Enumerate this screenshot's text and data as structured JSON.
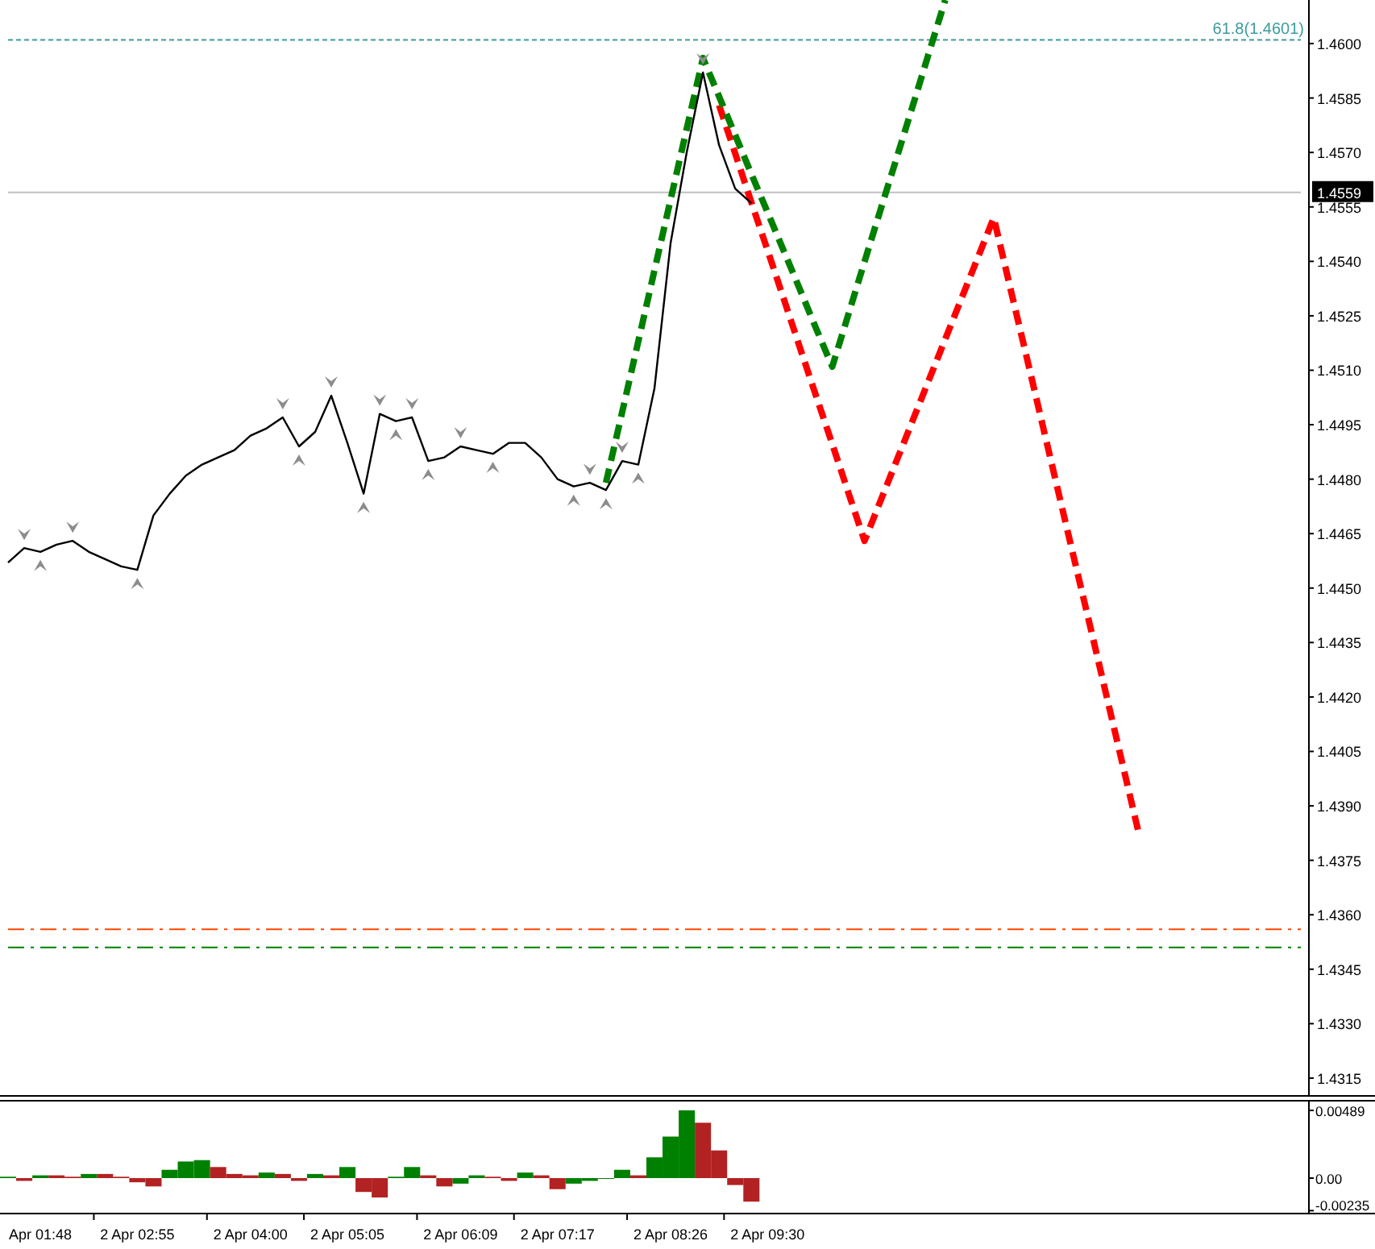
{
  "main_chart": {
    "chart_data": {
      "type": "line",
      "ylim": [
        1.43101,
        1.4612
      ],
      "categories": [
        null,
        null,
        null,
        null,
        null,
        null,
        null,
        null,
        null,
        null,
        null,
        null,
        null,
        null,
        null,
        null,
        null,
        null,
        null,
        null,
        null,
        null,
        null,
        null,
        null,
        null,
        null,
        null,
        null,
        null,
        null,
        null,
        null,
        null,
        null,
        null,
        null,
        null,
        null,
        null,
        null,
        null,
        null,
        null,
        null,
        null,
        null,
        null,
        null,
        null,
        null,
        null,
        null,
        null,
        null,
        null,
        null,
        null,
        null,
        null,
        null,
        null,
        null,
        null,
        null,
        null,
        null,
        null,
        null,
        null,
        null,
        null,
        null,
        null,
        null,
        null,
        null,
        null,
        null,
        null,
        null
      ],
      "yticks": [
        {
          "value": 1.46,
          "label": "1.4600"
        },
        {
          "value": 1.4585,
          "label": "1.4585"
        },
        {
          "value": 1.457,
          "label": "1.4570"
        },
        {
          "value": 1.4555,
          "label": "1.4555"
        },
        {
          "value": 1.454,
          "label": "1.4540"
        },
        {
          "value": 1.4525,
          "label": "1.4525"
        },
        {
          "value": 1.451,
          "label": "1.4510"
        },
        {
          "value": 1.4495,
          "label": "1.4495"
        },
        {
          "value": 1.448,
          "label": "1.4480"
        },
        {
          "value": 1.4465,
          "label": "1.4465"
        },
        {
          "value": 1.445,
          "label": "1.4450"
        },
        {
          "value": 1.4435,
          "label": "1.4435"
        },
        {
          "value": 1.442,
          "label": "1.4420"
        },
        {
          "value": 1.4405,
          "label": "1.4405"
        },
        {
          "value": 1.439,
          "label": "1.4390"
        },
        {
          "value": 1.4375,
          "label": "1.4375"
        },
        {
          "value": 1.436,
          "label": "1.4360"
        },
        {
          "value": 1.4345,
          "label": "1.4345"
        },
        {
          "value": 1.433,
          "label": "1.4330"
        },
        {
          "value": 1.4315,
          "label": "1.4315"
        }
      ],
      "series": [
        {
          "color": "#000000",
          "values": [
            1.4457,
            1.4461,
            1.446,
            1.4462,
            1.4463,
            1.446,
            1.4458,
            1.4456,
            1.4455,
            1.447,
            1.4476,
            1.4481,
            1.4484,
            1.4486,
            1.4488,
            1.4492,
            1.4494,
            1.4497,
            1.4489,
            1.4493,
            1.4503,
            1.449,
            1.4476,
            1.4498,
            1.4496,
            1.4497,
            1.4485,
            1.4486,
            1.4489,
            1.4488,
            1.4487,
            1.449,
            1.449,
            1.4486,
            1.448,
            1.4478,
            1.4479,
            1.4477,
            1.4485,
            1.4484,
            1.4505,
            1.4545,
            1.457,
            1.4592,
            1.4572,
            1.456,
            1.4556,
            null,
            null,
            null,
            null,
            null,
            null,
            null,
            null,
            null,
            null,
            null,
            null,
            null,
            null,
            null,
            null,
            null,
            null,
            null,
            null,
            null,
            null,
            null,
            null,
            null,
            null,
            null,
            null,
            null,
            null,
            null,
            null,
            null,
            null
          ]
        },
        {
          "color": "#008000",
          "line_style": "dashed",
          "values": [
            null,
            null,
            null,
            null,
            null,
            null,
            null,
            null,
            null,
            null,
            null,
            null,
            null,
            null,
            null,
            null,
            null,
            null,
            null,
            null,
            null,
            null,
            null,
            null,
            null,
            null,
            null,
            null,
            null,
            null,
            null,
            null,
            null,
            null,
            null,
            null,
            null,
            1.4479,
            1.44985,
            1.4518,
            1.45375,
            1.4557,
            1.45765,
            1.4596,
            1.45854,
            1.45748,
            1.45641,
            1.45535,
            1.45429,
            1.45323,
            1.45216,
            1.4511,
            1.45254,
            1.45399,
            1.45543,
            1.45687,
            1.45831,
            1.45976,
            1.4612,
            null,
            null,
            null,
            null,
            null,
            null,
            null,
            null,
            null,
            null,
            null,
            null,
            null,
            null,
            null,
            null,
            null,
            null,
            null,
            null,
            null,
            null
          ]
        },
        {
          "color": "#ff0000",
          "line_style": "dashed",
          "values": [
            null,
            null,
            null,
            null,
            null,
            null,
            null,
            null,
            null,
            null,
            null,
            null,
            null,
            null,
            null,
            null,
            null,
            null,
            null,
            null,
            null,
            null,
            null,
            null,
            null,
            null,
            null,
            null,
            null,
            null,
            null,
            null,
            null,
            null,
            null,
            null,
            null,
            null,
            null,
            null,
            null,
            null,
            null,
            null,
            1.4583,
            1.45697,
            1.45563,
            1.4543,
            1.45297,
            1.45163,
            1.4503,
            1.44897,
            1.44763,
            1.4463,
            1.44741,
            1.44853,
            1.44964,
            1.45075,
            1.45186,
            1.45298,
            1.45409,
            1.4552,
            1.45331,
            1.45142,
            1.44953,
            1.44764,
            1.44576,
            1.44387,
            1.44198,
            1.44009,
            1.4382,
            null,
            null,
            null,
            null,
            null,
            null,
            null,
            null,
            null,
            null
          ]
        },
        {
          "name": "61.8(1.4601)",
          "color": "#3c9c9c",
          "line_style": "dotted",
          "values": [
            1.4601,
            1.4601,
            1.4601,
            1.4601,
            1.4601,
            1.4601,
            1.4601,
            1.4601,
            1.4601,
            1.4601,
            1.4601,
            1.4601,
            1.4601,
            1.4601,
            1.4601,
            1.4601,
            1.4601,
            1.4601,
            1.4601,
            1.4601,
            1.4601,
            1.4601,
            1.4601,
            1.4601,
            1.4601,
            1.4601,
            1.4601,
            1.4601,
            1.4601,
            1.4601,
            1.4601,
            1.4601,
            1.4601,
            1.4601,
            1.4601,
            1.4601,
            1.4601,
            1.4601,
            1.4601,
            1.4601,
            1.4601,
            1.4601,
            1.4601,
            1.4601,
            1.4601,
            1.4601,
            1.4601,
            1.4601,
            1.4601,
            1.4601,
            1.4601,
            1.4601,
            1.4601,
            1.4601,
            1.4601,
            1.4601,
            1.4601,
            1.4601,
            1.4601,
            1.4601,
            1.4601,
            1.4601,
            1.4601,
            1.4601,
            1.4601,
            1.4601,
            1.4601,
            1.4601,
            1.4601,
            1.4601,
            1.4601,
            1.4601,
            1.4601,
            1.4601,
            1.4601,
            1.4601,
            1.4601,
            1.4601,
            1.4601,
            1.4601,
            1.4601
          ]
        },
        {
          "name": "1.4559",
          "color": "#c0c0c0",
          "line_style": "solid",
          "values": [
            1.4559,
            1.4559,
            1.4559,
            1.4559,
            1.4559,
            1.4559,
            1.4559,
            1.4559,
            1.4559,
            1.4559,
            1.4559,
            1.4559,
            1.4559,
            1.4559,
            1.4559,
            1.4559,
            1.4559,
            1.4559,
            1.4559,
            1.4559,
            1.4559,
            1.4559,
            1.4559,
            1.4559,
            1.4559,
            1.4559,
            1.4559,
            1.4559,
            1.4559,
            1.4559,
            1.4559,
            1.4559,
            1.4559,
            1.4559,
            1.4559,
            1.4559,
            1.4559,
            1.4559,
            1.4559,
            1.4559,
            1.4559,
            1.4559,
            1.4559,
            1.4559,
            1.4559,
            1.4559,
            1.4559,
            1.4559,
            1.4559,
            1.4559,
            1.4559,
            1.4559,
            1.4559,
            1.4559,
            1.4559,
            1.4559,
            1.4559,
            1.4559,
            1.4559,
            1.4559,
            1.4559,
            1.4559,
            1.4559,
            1.4559,
            1.4559,
            1.4559,
            1.4559,
            1.4559,
            1.4559,
            1.4559,
            1.4559,
            1.4559,
            1.4559,
            1.4559,
            1.4559,
            1.4559,
            1.4559,
            1.4559,
            1.4559,
            1.4559,
            1.4559
          ]
        },
        {
          "color": "#ff4500",
          "line_style": "dashdot",
          "values": [
            1.4356,
            1.4356,
            1.4356,
            1.4356,
            1.4356,
            1.4356,
            1.4356,
            1.4356,
            1.4356,
            1.4356,
            1.4356,
            1.4356,
            1.4356,
            1.4356,
            1.4356,
            1.4356,
            1.4356,
            1.4356,
            1.4356,
            1.4356,
            1.4356,
            1.4356,
            1.4356,
            1.4356,
            1.4356,
            1.4356,
            1.4356,
            1.4356,
            1.4356,
            1.4356,
            1.4356,
            1.4356,
            1.4356,
            1.4356,
            1.4356,
            1.4356,
            1.4356,
            1.4356,
            1.4356,
            1.4356,
            1.4356,
            1.4356,
            1.4356,
            1.4356,
            1.4356,
            1.4356,
            1.4356,
            1.4356,
            1.4356,
            1.4356,
            1.4356,
            1.4356,
            1.4356,
            1.4356,
            1.4356,
            1.4356,
            1.4356,
            1.4356,
            1.4356,
            1.4356,
            1.4356,
            1.4356,
            1.4356,
            1.4356,
            1.4356,
            1.4356,
            1.4356,
            1.4356,
            1.4356,
            1.4356,
            1.4356,
            1.4356,
            1.4356,
            1.4356,
            1.4356,
            1.4356,
            1.4356,
            1.4356,
            1.4356,
            1.4356,
            1.4356
          ]
        },
        {
          "color": "#008000",
          "line_style": "dashdot",
          "values": [
            1.4351,
            1.4351,
            1.4351,
            1.4351,
            1.4351,
            1.4351,
            1.4351,
            1.4351,
            1.4351,
            1.4351,
            1.4351,
            1.4351,
            1.4351,
            1.4351,
            1.4351,
            1.4351,
            1.4351,
            1.4351,
            1.4351,
            1.4351,
            1.4351,
            1.4351,
            1.4351,
            1.4351,
            1.4351,
            1.4351,
            1.4351,
            1.4351,
            1.4351,
            1.4351,
            1.4351,
            1.4351,
            1.4351,
            1.4351,
            1.4351,
            1.4351,
            1.4351,
            1.4351,
            1.4351,
            1.4351,
            1.4351,
            1.4351,
            1.4351,
            1.4351,
            1.4351,
            1.4351,
            1.4351,
            1.4351,
            1.4351,
            1.4351,
            1.4351,
            1.4351,
            1.4351,
            1.4351,
            1.4351,
            1.4351,
            1.4351,
            1.4351,
            1.4351,
            1.4351,
            1.4351,
            1.4351,
            1.4351,
            1.4351,
            1.4351,
            1.4351,
            1.4351,
            1.4351,
            1.4351,
            1.4351,
            1.4351,
            1.4351,
            1.4351,
            1.4351,
            1.4351,
            1.4351,
            1.4351,
            1.4351,
            1.4351,
            1.4351,
            1.4351
          ]
        }
      ]
    }
  },
  "oscillator": {
    "chart_data": {
      "type": "bar",
      "stacked": true,
      "ylim": [
        -0.00256,
        0.00559
      ],
      "yticks": [
        {
          "value": 0.00489,
          "label": "0.00489"
        },
        {
          "value": 0,
          "label": "0.00"
        },
        {
          "value": -0.00235,
          "label": "-0.00235"
        }
      ],
      "categories": [
        null,
        null,
        "Apr 01:48",
        null,
        null,
        null,
        null,
        null,
        "2 Apr 02:55",
        null,
        null,
        null,
        null,
        null,
        null,
        "2 Apr 04:00",
        null,
        null,
        null,
        null,
        null,
        "2 Apr 05:05",
        null,
        null,
        null,
        null,
        null,
        null,
        "2 Apr 06:09",
        null,
        null,
        null,
        null,
        null,
        "2 Apr 07:17",
        null,
        null,
        null,
        null,
        null,
        null,
        "2 Apr 08:26",
        null,
        null,
        null,
        null,
        null,
        "2 Apr 09:30",
        null,
        null,
        null,
        null,
        null,
        null,
        null,
        null,
        null,
        null,
        null,
        null,
        null,
        null,
        null,
        null,
        null,
        null,
        null,
        null,
        null,
        null,
        null,
        null,
        null,
        null,
        null,
        null,
        null,
        null,
        null,
        null,
        null
      ],
      "series": [
        {
          "color": "#008000",
          "values": [
            0.0001,
            null,
            0.0002,
            null,
            null,
            0.0003,
            null,
            null,
            null,
            null,
            0.0006,
            0.0012,
            0.0013,
            null,
            null,
            null,
            0.0004,
            null,
            null,
            0.0003,
            null,
            0.0008,
            null,
            null,
            0.0001,
            0.0008,
            null,
            null,
            -0.0004,
            0.0002,
            null,
            null,
            0.0004,
            null,
            null,
            -0.0004,
            -0.0002,
            0.0,
            0.0006,
            null,
            0.0015,
            0.003,
            0.0049,
            null,
            null,
            null,
            null,
            null,
            null,
            null,
            null,
            null,
            null,
            null,
            null,
            null,
            null,
            null,
            null,
            null,
            null,
            null,
            null,
            null,
            null,
            null,
            null,
            null,
            null,
            null,
            null,
            null,
            null,
            null,
            null,
            null,
            null,
            null,
            null,
            null,
            null
          ]
        },
        {
          "color": "#b22222",
          "values": [
            null,
            -0.0002,
            null,
            0.0002,
            0.0001,
            null,
            0.0003,
            0.0001,
            -0.0003,
            -0.0006,
            null,
            null,
            null,
            0.0008,
            0.0003,
            0.0002,
            null,
            0.0003,
            -0.0002,
            null,
            0.0002,
            null,
            -0.001,
            -0.0014,
            null,
            null,
            0.0002,
            -0.0006,
            null,
            null,
            0.0001,
            -0.0002,
            null,
            0.0002,
            -0.0008,
            null,
            null,
            null,
            null,
            0.0002,
            null,
            null,
            null,
            0.004,
            0.002,
            -0.0005,
            -0.0017,
            null,
            null,
            null,
            null,
            null,
            null,
            null,
            null,
            null,
            null,
            null,
            null,
            null,
            null,
            null,
            null,
            null,
            null,
            null,
            null,
            null,
            null,
            null,
            null,
            null,
            null,
            null,
            null,
            null,
            null,
            null,
            null,
            null,
            null
          ]
        }
      ]
    }
  }
}
